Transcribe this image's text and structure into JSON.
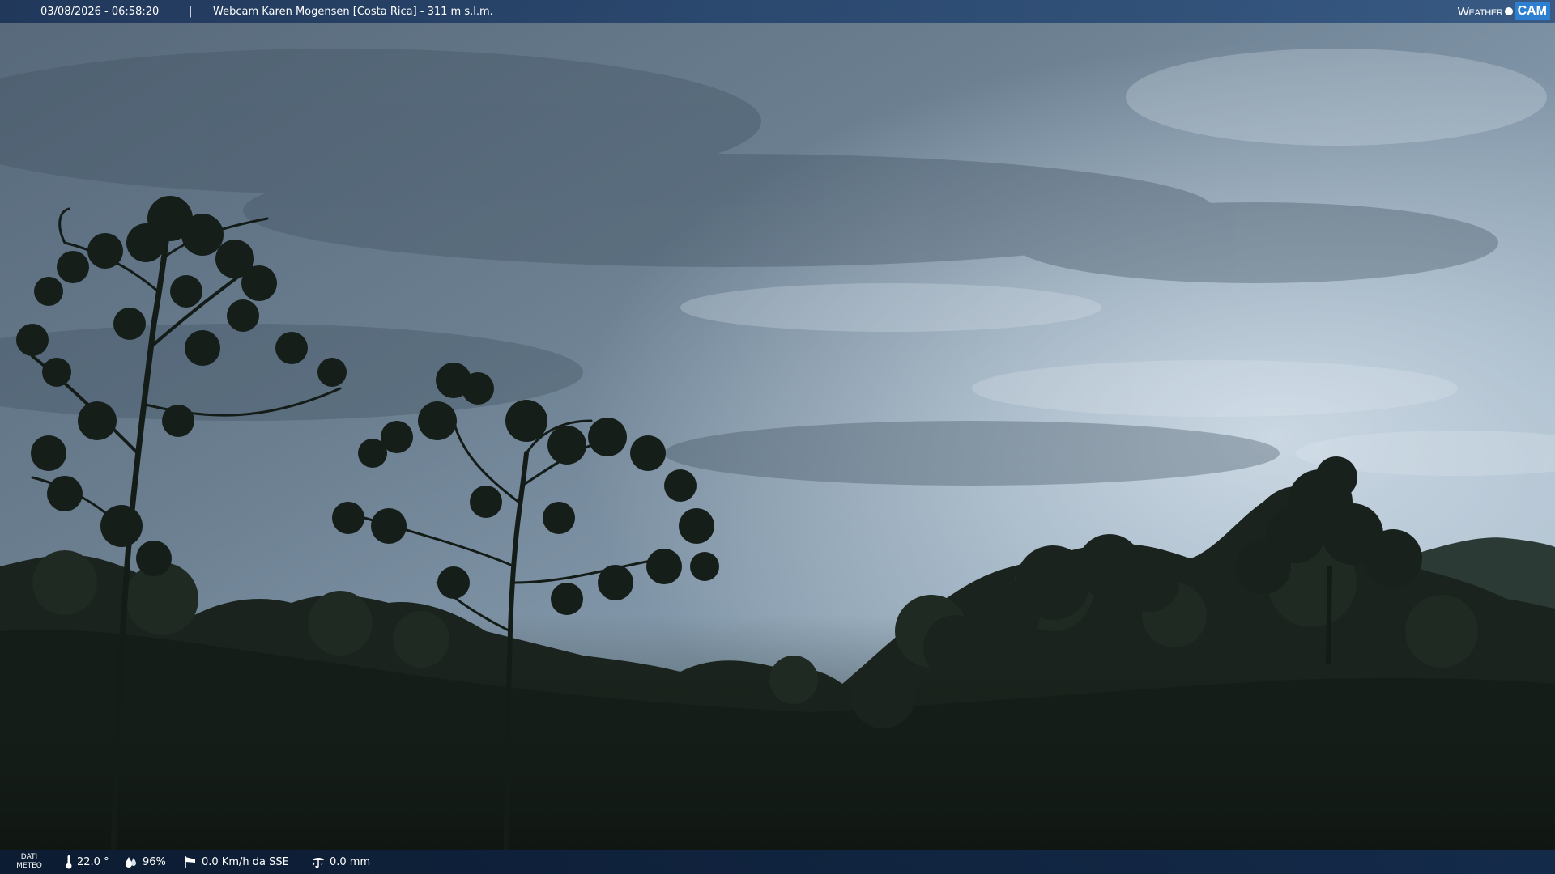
{
  "header": {
    "datetime": "03/08/2026 - 06:58:20",
    "separator": "|",
    "title": "Webcam Karen Mogensen [Costa Rica]  - 311 m s.l.m.",
    "logo_word": "Weather",
    "logo_box": "CAM"
  },
  "footer": {
    "label_line1": "DATI",
    "label_line2": "METEO",
    "temperature": "22.0 °",
    "humidity": "96%",
    "wind": "0.0 Km/h da SSE",
    "rain": "0.0 mm"
  },
  "icons": {
    "temperature": "thermometer-icon",
    "humidity": "humidity-drop-icon",
    "wind": "wind-sock-icon",
    "rain": "rain-gauge-icon"
  },
  "colors": {
    "topbar": "#1c3458",
    "bottombar": "#0c1c34",
    "logo_accent": "#2d7fd0",
    "sky_light": "#c9d7e2",
    "sky_dark": "#4f6070",
    "foliage": "#17201a"
  }
}
